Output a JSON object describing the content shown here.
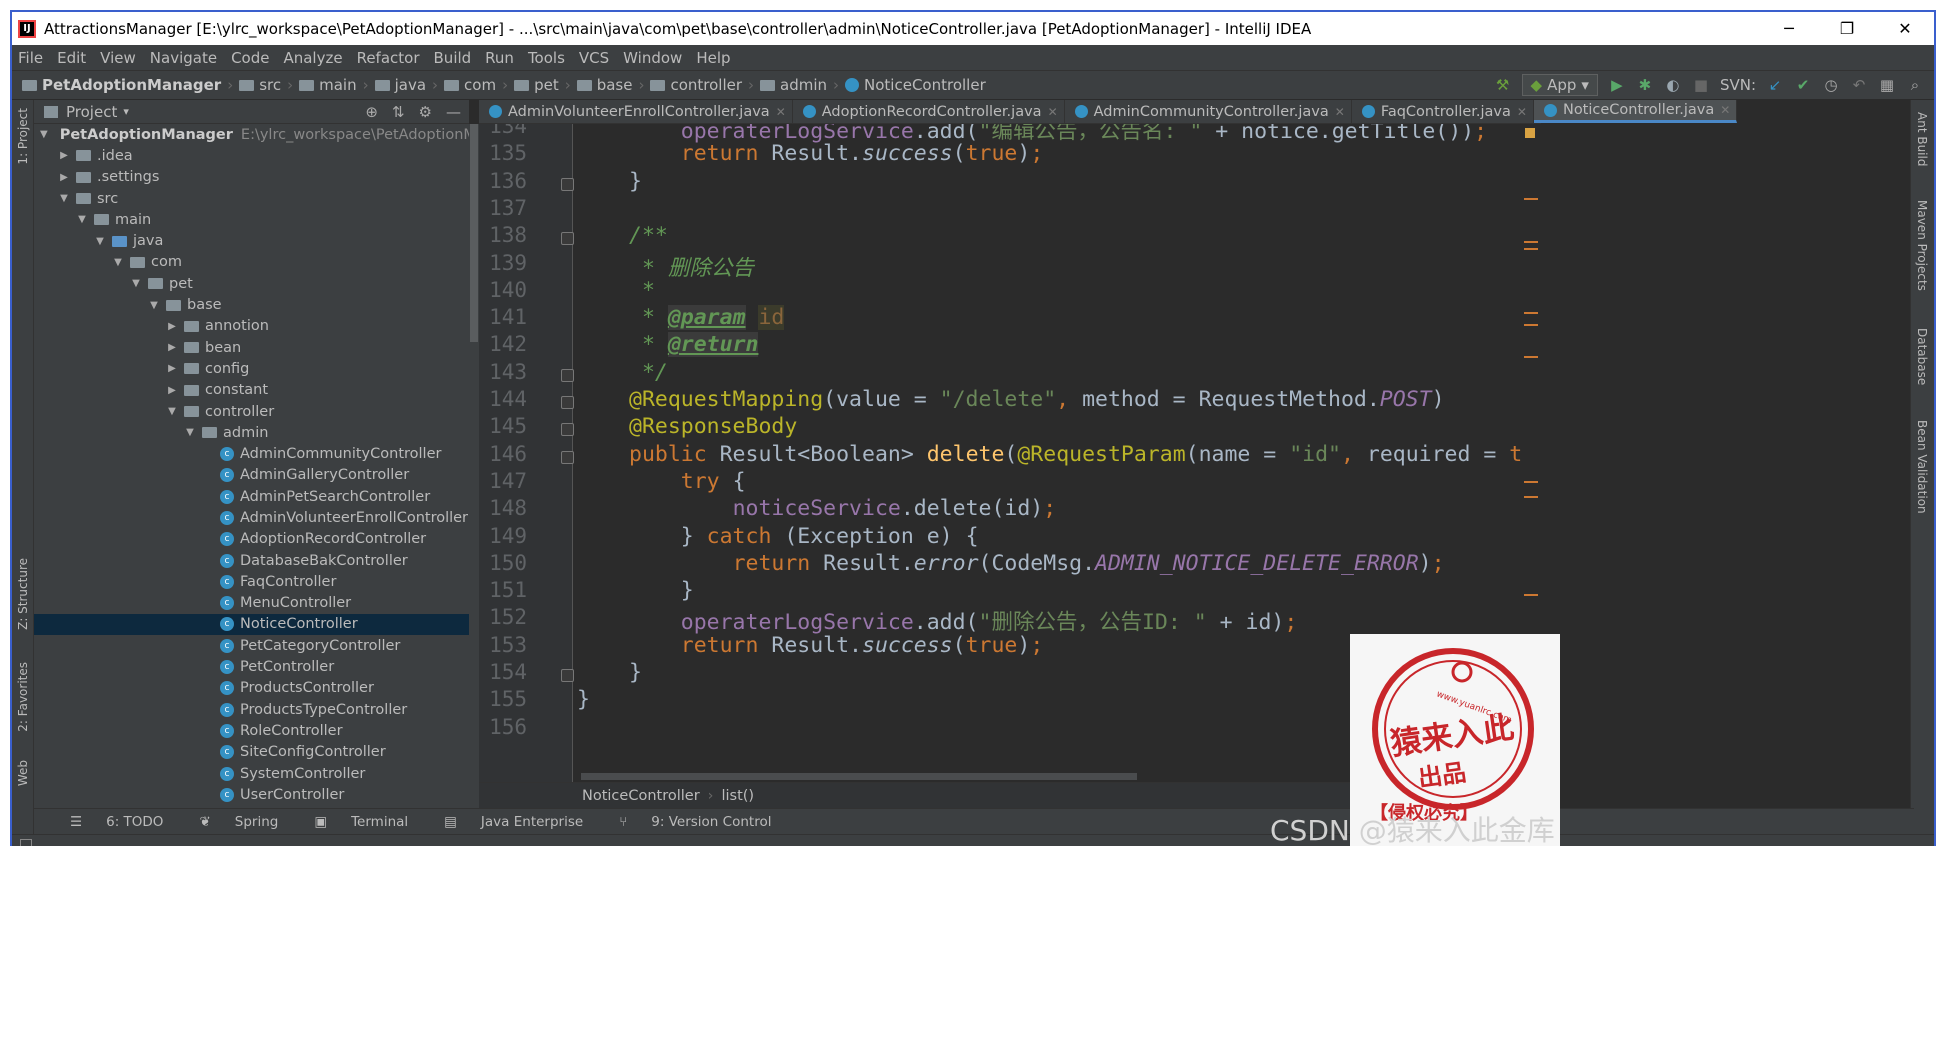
{
  "window": {
    "title": "AttractionsManager [E:\\ylrc_workspace\\PetAdoptionManager] - ...\\src\\main\\java\\com\\pet\\base\\controller\\admin\\NoticeController.java [PetAdoptionManager] - IntelliJ IDEA",
    "minimize": "─",
    "restore": "❐",
    "close": "✕"
  },
  "menu": [
    "File",
    "Edit",
    "View",
    "Navigate",
    "Code",
    "Analyze",
    "Refactor",
    "Build",
    "Run",
    "Tools",
    "VCS",
    "Window",
    "Help"
  ],
  "breadcrumb": [
    "PetAdoptionManager",
    "src",
    "main",
    "java",
    "com",
    "pet",
    "base",
    "controller",
    "admin",
    "NoticeController"
  ],
  "toolbar": {
    "run_config": "App",
    "svn_label": "SVN:"
  },
  "left_strip": {
    "project": "1: Project",
    "structure": "Z: Structure",
    "favorites": "2: Favorites",
    "web": "Web"
  },
  "right_strip": {
    "ant": "Ant Build",
    "maven": "Maven Projects",
    "database": "Database",
    "bean": "Bean Validation"
  },
  "project_panel": {
    "title": "Project",
    "root_name": "PetAdoptionManager",
    "root_path": "E:\\ylrc_workspace\\PetAdoptionManager",
    "items": [
      {
        "label": ".idea",
        "depth": 1,
        "arrow": "▶",
        "type": "folder"
      },
      {
        "label": ".settings",
        "depth": 1,
        "arrow": "▶",
        "type": "folder"
      },
      {
        "label": "src",
        "depth": 1,
        "arrow": "▼",
        "type": "folder"
      },
      {
        "label": "main",
        "depth": 2,
        "arrow": "▼",
        "type": "folder"
      },
      {
        "label": "java",
        "depth": 3,
        "arrow": "▼",
        "type": "blue"
      },
      {
        "label": "com",
        "depth": 4,
        "arrow": "▼",
        "type": "folder"
      },
      {
        "label": "pet",
        "depth": 5,
        "arrow": "▼",
        "type": "folder"
      },
      {
        "label": "base",
        "depth": 6,
        "arrow": "▼",
        "type": "folder"
      },
      {
        "label": "annotion",
        "depth": 7,
        "arrow": "▶",
        "type": "folder"
      },
      {
        "label": "bean",
        "depth": 7,
        "arrow": "▶",
        "type": "folder"
      },
      {
        "label": "config",
        "depth": 7,
        "arrow": "▶",
        "type": "folder"
      },
      {
        "label": "constant",
        "depth": 7,
        "arrow": "▶",
        "type": "folder"
      },
      {
        "label": "controller",
        "depth": 7,
        "arrow": "▼",
        "type": "folder"
      },
      {
        "label": "admin",
        "depth": 8,
        "arrow": "▼",
        "type": "folder"
      },
      {
        "label": "AdminCommunityController",
        "depth": 9,
        "arrow": "",
        "type": "class"
      },
      {
        "label": "AdminGalleryController",
        "depth": 9,
        "arrow": "",
        "type": "class"
      },
      {
        "label": "AdminPetSearchController",
        "depth": 9,
        "arrow": "",
        "type": "class"
      },
      {
        "label": "AdminVolunteerEnrollController",
        "depth": 9,
        "arrow": "",
        "type": "class"
      },
      {
        "label": "AdoptionRecordController",
        "depth": 9,
        "arrow": "",
        "type": "class"
      },
      {
        "label": "DatabaseBakController",
        "depth": 9,
        "arrow": "",
        "type": "class"
      },
      {
        "label": "FaqController",
        "depth": 9,
        "arrow": "",
        "type": "class"
      },
      {
        "label": "MenuController",
        "depth": 9,
        "arrow": "",
        "type": "class"
      },
      {
        "label": "NoticeController",
        "depth": 9,
        "arrow": "",
        "type": "class",
        "selected": true
      },
      {
        "label": "PetCategoryController",
        "depth": 9,
        "arrow": "",
        "type": "class"
      },
      {
        "label": "PetController",
        "depth": 9,
        "arrow": "",
        "type": "class"
      },
      {
        "label": "ProductsController",
        "depth": 9,
        "arrow": "",
        "type": "class"
      },
      {
        "label": "ProductsTypeController",
        "depth": 9,
        "arrow": "",
        "type": "class"
      },
      {
        "label": "RoleController",
        "depth": 9,
        "arrow": "",
        "type": "class"
      },
      {
        "label": "SiteConfigController",
        "depth": 9,
        "arrow": "",
        "type": "class"
      },
      {
        "label": "SystemController",
        "depth": 9,
        "arrow": "",
        "type": "class"
      },
      {
        "label": "UserController",
        "depth": 9,
        "arrow": "",
        "type": "class"
      }
    ]
  },
  "tabs": [
    {
      "label": "AdminVolunteerEnrollController.java",
      "active": false
    },
    {
      "label": "AdoptionRecordController.java",
      "active": false
    },
    {
      "label": "AdminCommunityController.java",
      "active": false
    },
    {
      "label": "FaqController.java",
      "active": false
    },
    {
      "label": "NoticeController.java",
      "active": true
    }
  ],
  "code_lines": [
    {
      "n": "134",
      "html": "    <span class='fld'>operaterLogService</span>.add(<span class='st'>\"编辑公告，公告名: \"</span> + notice.getTitle())<span class='kw'>;</span>"
    },
    {
      "n": "135",
      "html": "    <span class='kw'>return</span> Result.<span class='it'>success</span>(<span class='kw'>true</span>)<span class='kw'>;</span>"
    },
    {
      "n": "136",
      "html": "}"
    },
    {
      "n": "137",
      "html": ""
    },
    {
      "n": "138",
      "html": "<span class='doc'>/**</span>"
    },
    {
      "n": "139",
      "html": "<span class='doc'> * 删除公告</span>"
    },
    {
      "n": "140",
      "html": "<span class='doc'> *</span>"
    },
    {
      "n": "141",
      "html": "<span class='doc'> * </span><span class='doctag'>@param</span> <span class='docval'>id</span>"
    },
    {
      "n": "142",
      "html": "<span class='doc'> * </span><span class='doctag'>@return</span>"
    },
    {
      "n": "143",
      "html": "<span class='doc'> */</span>"
    },
    {
      "n": "144",
      "html": "<span class='ann'>@RequestMapping</span>(value = <span class='st'>\"/delete\"</span><span class='kw'>,</span> method = RequestMethod.<span class='fld it'>POST</span>)"
    },
    {
      "n": "145",
      "html": "<span class='ann'>@ResponseBody</span>"
    },
    {
      "n": "146",
      "html": "<span class='kw'>public</span> Result&lt;Boolean&gt; <span class='fn'>delete</span>(<span class='ann'>@RequestParam</span>(name = <span class='st'>\"id\"</span><span class='kw'>,</span> required = <span class='kw'>tru</span>"
    },
    {
      "n": "147",
      "html": "    <span class='kw'>try</span> {"
    },
    {
      "n": "148",
      "html": "        <span class='fld'>noticeService</span>.delete(id)<span class='kw'>;</span>"
    },
    {
      "n": "149",
      "html": "    } <span class='kw'>catch</span> (Exception e) {"
    },
    {
      "n": "150",
      "html": "        <span class='kw'>return</span> Result.<span class='it'>error</span>(CodeMsg.<span class='fld it'>ADMIN_NOTICE_DELETE_ERROR</span>)<span class='kw'>;</span>"
    },
    {
      "n": "151",
      "html": "    }"
    },
    {
      "n": "152",
      "html": "    <span class='fld'>operaterLogService</span>.add(<span class='st'>\"删除公告，公告ID: \"</span> + id)<span class='kw'>;</span>"
    },
    {
      "n": "153",
      "html": "    <span class='kw'>return</span> Result.<span class='it'>success</span>(<span class='kw'>true</span>)<span class='kw'>;</span>"
    },
    {
      "n": "154",
      "html": "}"
    },
    {
      "n": "155",
      "html": "}"
    },
    {
      "n": "156",
      "html": ""
    }
  ],
  "code_indent": {
    "155": -1
  },
  "editor_breadcrumb": {
    "class": "NoticeController",
    "method": "list()"
  },
  "bottom_tools": [
    "6: TODO",
    "Spring",
    "Terminal",
    "Java Enterprise",
    "9: Version Control"
  ],
  "watermark": {
    "stamp_top": "猿来入此",
    "stamp_bottom": "出品",
    "stamp_url": "www.yuanlrc.com",
    "stamp_note": "【侵权必究】",
    "csdn": "CSDN @猿来入此金库"
  }
}
